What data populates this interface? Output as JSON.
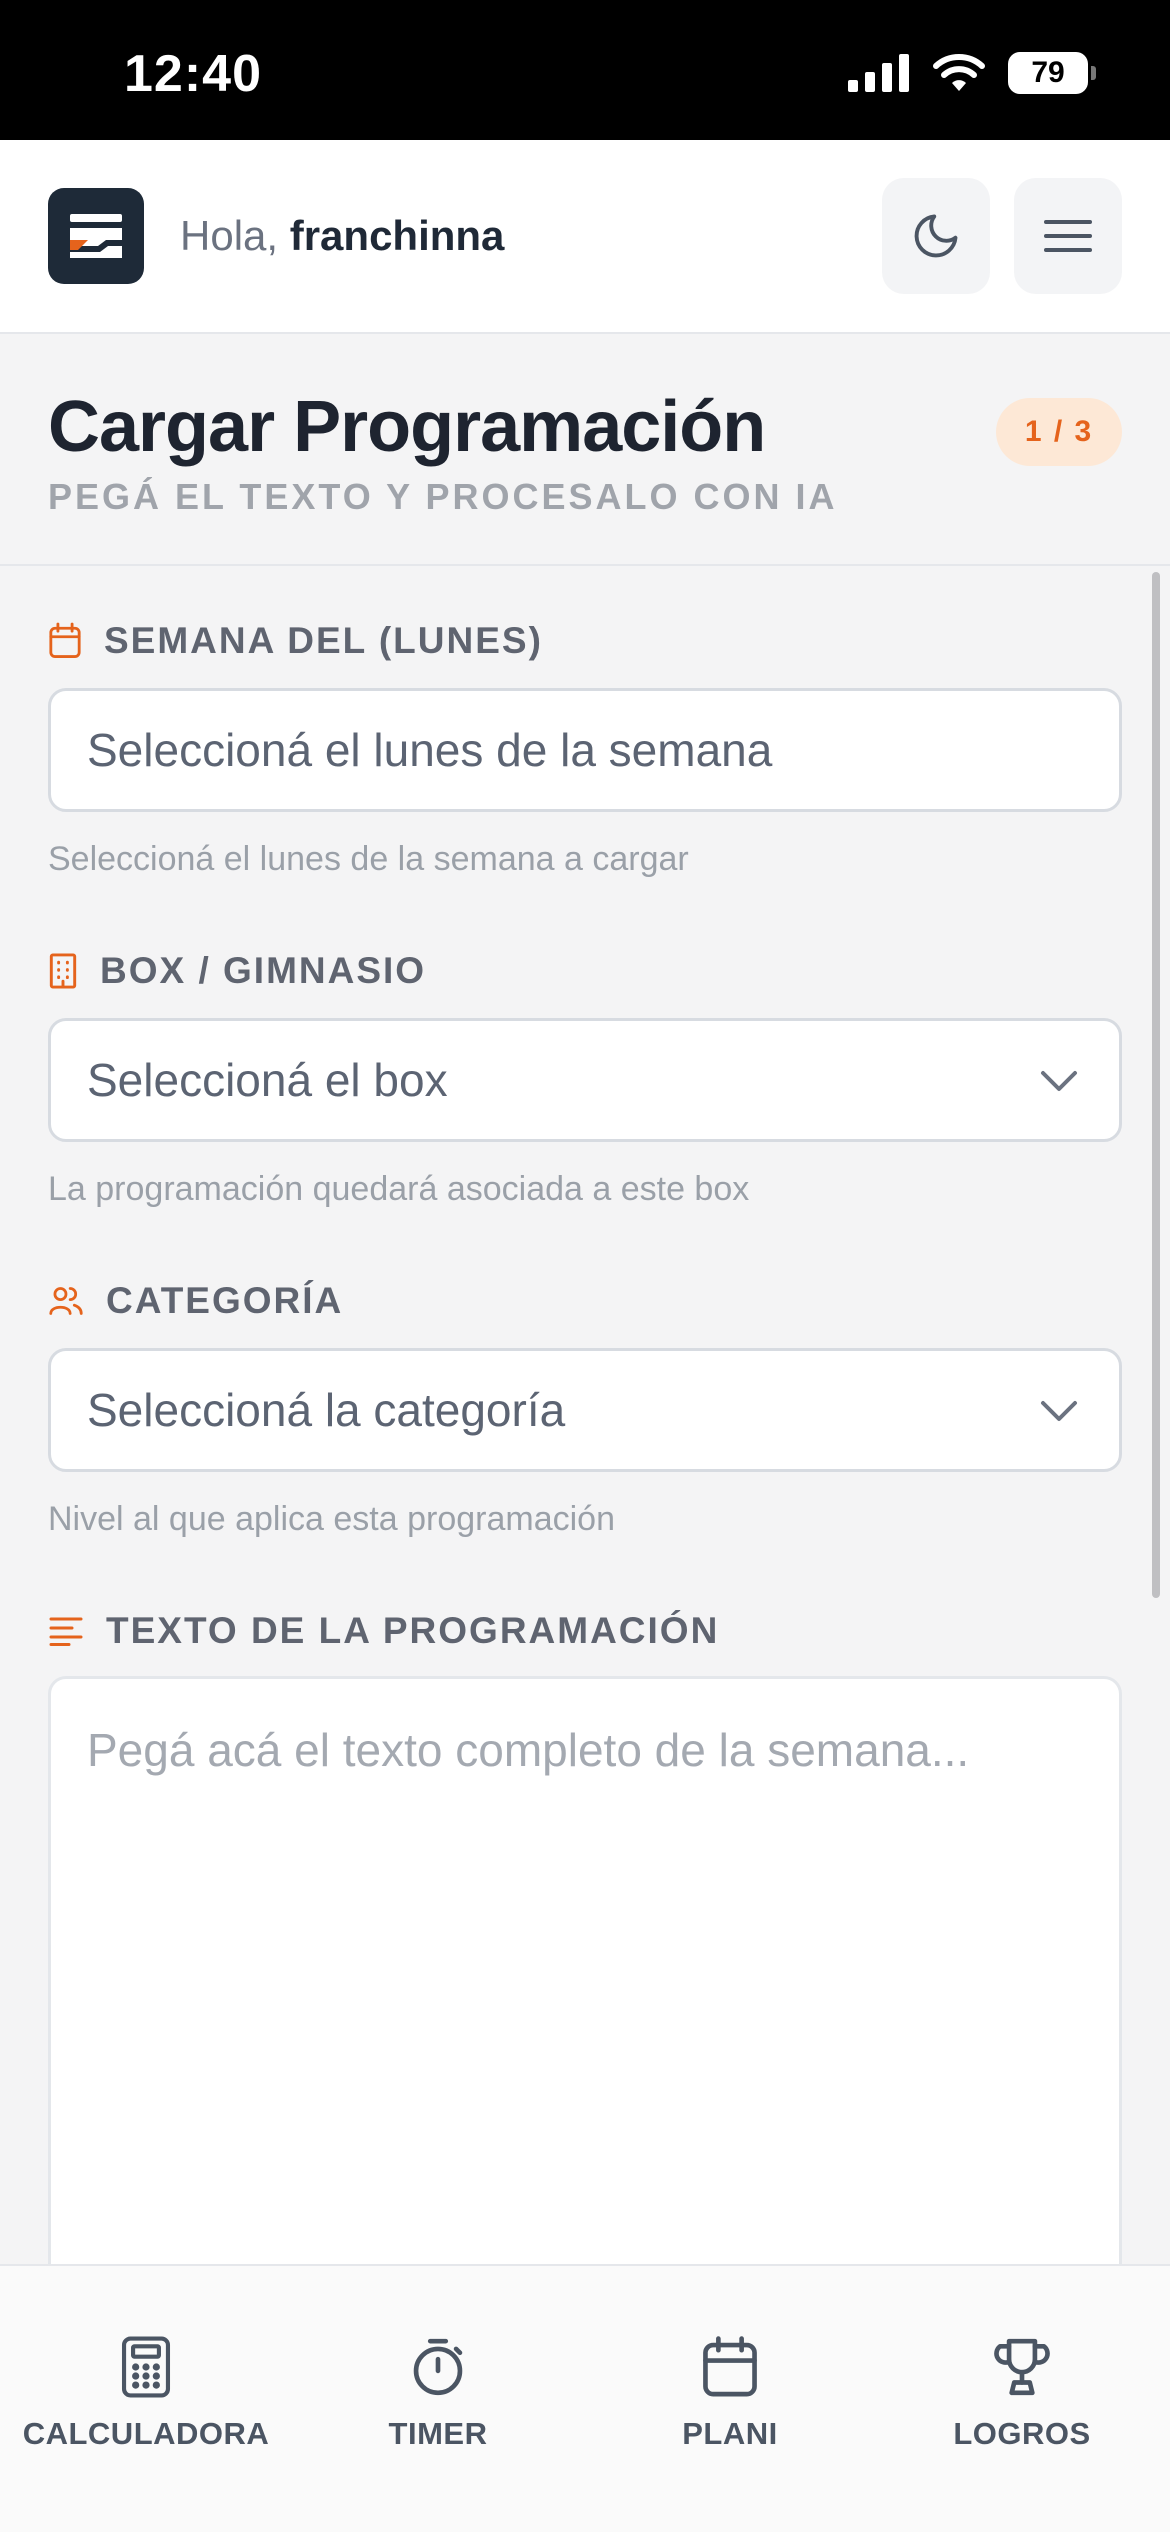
{
  "status_bar": {
    "time": "12:40",
    "battery": "79"
  },
  "header": {
    "greeting_prefix": "Hola, ",
    "username": "franchinna"
  },
  "page": {
    "title": "Cargar Programación",
    "subtitle": "PEGÁ EL TEXTO Y PROCESALO CON IA",
    "step": "1 / 3"
  },
  "form": {
    "week": {
      "label": "SEMANA DEL (LUNES)",
      "placeholder": "Seleccioná el lunes de la semana",
      "helper": "Seleccioná el lunes de la semana a cargar"
    },
    "box": {
      "label": "BOX / GIMNASIO",
      "selected": "Seleccioná el box",
      "helper": "La programación quedará asociada a este box"
    },
    "category": {
      "label": "CATEGORÍA",
      "selected": "Seleccioná la categoría",
      "helper": "Nivel al que aplica esta programación"
    },
    "text": {
      "label": "TEXTO DE LA PROGRAMACIÓN",
      "placeholder": "Pegá acá el texto completo de la semana..."
    }
  },
  "bottom_nav": {
    "calculator": "CALCULADORA",
    "timer": "TIMER",
    "plan": "PLANI",
    "achievements": "LOGROS"
  },
  "colors": {
    "accent": "#e5631c",
    "dark": "#1e2a38"
  }
}
